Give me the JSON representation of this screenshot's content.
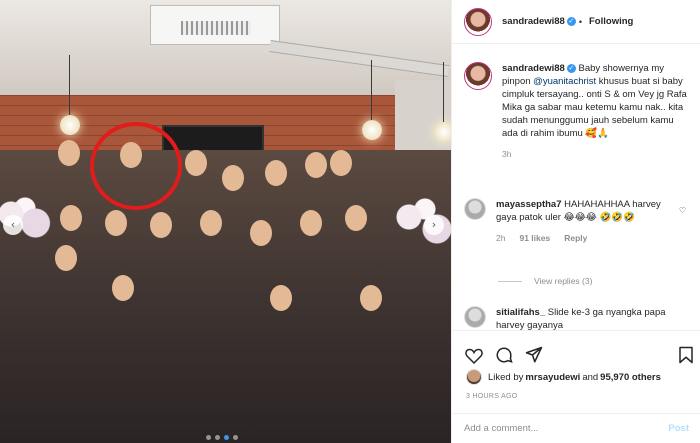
{
  "header": {
    "username": "sandradewi88",
    "separator": "•",
    "follow_status": "Following"
  },
  "caption": {
    "username": "sandradewi88",
    "text_before": "Baby showernya my pinpon ",
    "mention": "@yuanitachrist",
    "text_after": " khusus buat si baby cimpluk tersayang.. onti S & om Vey jg Rafa Mika ga sabar mau ketemu kamu nak.. kita sudah menunggumu jauh sebelum kamu ada di rahim ibumu 🥰🙏",
    "time": "3h"
  },
  "comments": [
    {
      "username": "mayasseptha7",
      "text": "HAHAHAHHAA harvey gaya patok uler 😂😂😂 🤣🤣🤣",
      "time": "2h",
      "likes": "91 likes",
      "reply": "Reply"
    },
    {
      "username": "sitialifahs_",
      "text": "Slide ke-3 ga nyangka papa harvey gayanya"
    }
  ],
  "view_replies": "View replies (3)",
  "likes_summary": {
    "prefix": "Liked by ",
    "user": "mrsayudewi",
    "middle": " and ",
    "count": "95,970 others"
  },
  "posted_time": "3 HOURS AGO",
  "add_comment": {
    "placeholder": "Add a comment...",
    "post_label": "Post"
  },
  "carousel": {
    "slides": 4,
    "active_index": 2
  },
  "colors": {
    "accent": "#3897f0",
    "highlight_circle": "#e21b1b",
    "post_disabled": "#b2dffc"
  }
}
